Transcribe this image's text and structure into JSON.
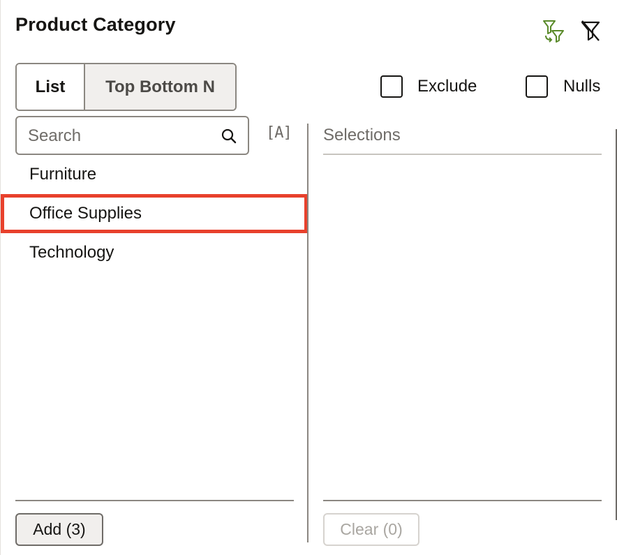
{
  "panel": {
    "title": "Product Category"
  },
  "header_icons": {
    "apply": "apply-filter-icon",
    "clear": "clear-filter-icon",
    "apply_color": "#5a8a2a"
  },
  "mode_tabs": {
    "list_label": "List",
    "topn_label": "Top Bottom N"
  },
  "options": {
    "exclude_label": "Exclude",
    "nulls_label": "Nulls"
  },
  "search": {
    "placeholder": "Search",
    "sort_label": "[A]"
  },
  "values": {
    "items": [
      {
        "label": "Furniture"
      },
      {
        "label": "Office Supplies"
      },
      {
        "label": "Technology"
      }
    ]
  },
  "selections": {
    "header": "Selections"
  },
  "footer": {
    "add_label": "Add (3)",
    "clear_label": "Clear (0)"
  },
  "colors": {
    "highlight": "#e8412c"
  }
}
